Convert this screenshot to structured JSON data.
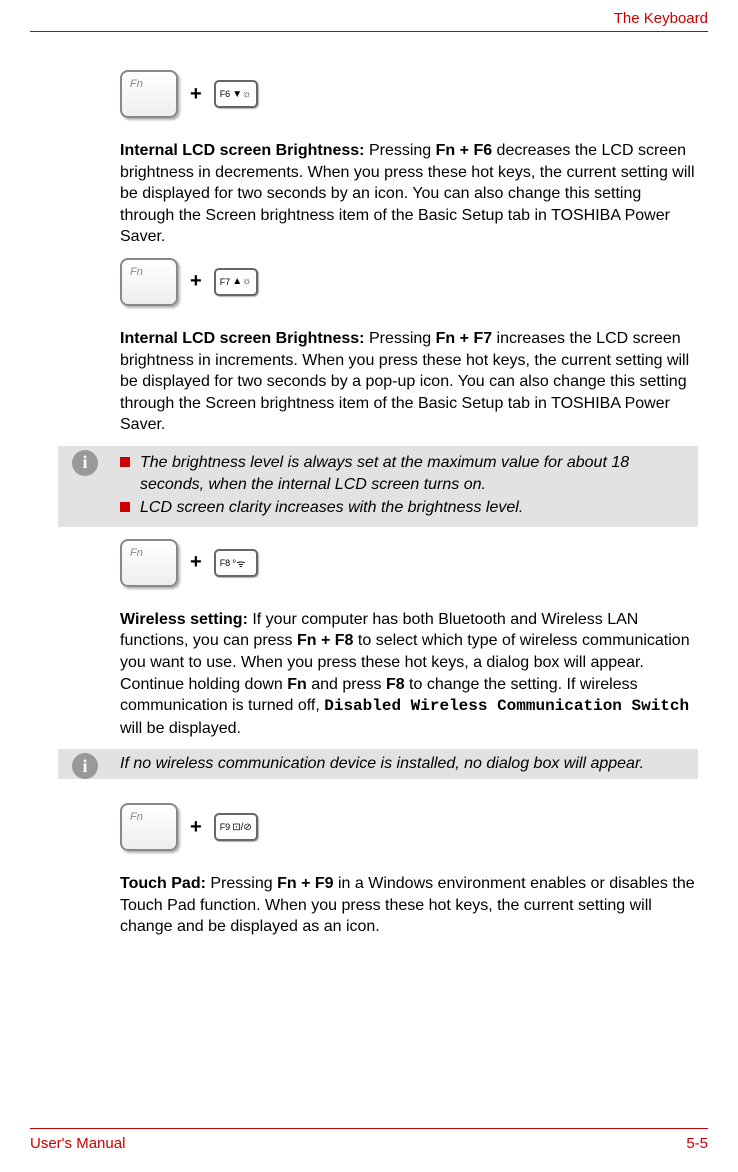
{
  "header": {
    "title": "The Keyboard"
  },
  "sections": {
    "s1": {
      "fkey": "F6",
      "title": "Internal LCD screen Brightness:",
      "keys": [
        "Fn",
        "F6"
      ],
      "body_pre": " Pressing ",
      "body_post": " decreases the LCD screen brightness in decrements. When you press these hot keys, the current setting will be displayed for two seconds by an icon. You can also change this setting through the Screen brightness item of the Basic Setup tab in TOSHIBA Power Saver."
    },
    "s2": {
      "fkey": "F7",
      "title": "Internal LCD screen Brightness:",
      "keys": [
        "Fn",
        "F7"
      ],
      "body_pre": " Pressing ",
      "body_post": " increases the LCD screen brightness in increments. When you press these hot keys, the current setting will be displayed for two seconds by a pop-up icon. You can also change this setting through the Screen brightness item of the Basic Setup tab in TOSHIBA Power Saver."
    },
    "note1": {
      "b1": "The brightness level is always set at the maximum value for about 18 seconds, when the internal LCD screen turns on.",
      "b2": "LCD screen clarity increases with the brightness level."
    },
    "s3": {
      "fkey": "F8",
      "title": "Wireless setting:",
      "keys": [
        "Fn",
        "F8",
        "Fn",
        "F8"
      ],
      "body": " If your computer has both Bluetooth and Wireless LAN functions, you can press ",
      "body2": " to select which type of wireless communication you want to use. When you press these hot keys, a dialog box will appear. Continue holding down ",
      "body3": " and press ",
      "body4": " to change the setting. If wireless communication is turned off, ",
      "mono": "Disabled Wireless Communication Switch",
      "body5": " will be displayed."
    },
    "note2": {
      "text": "If no wireless communication device is installed, no dialog box will appear."
    },
    "s4": {
      "fkey": "F9",
      "title": "Touch Pad:",
      "keys": [
        "Fn",
        "F9"
      ],
      "body_pre": " Pressing ",
      "body_post": " in a Windows environment enables or disables the Touch Pad function. When you press these hot keys, the current setting will change and be displayed as an icon."
    }
  },
  "footer": {
    "left": "User's Manual",
    "right": "5-5"
  },
  "plus": "+"
}
